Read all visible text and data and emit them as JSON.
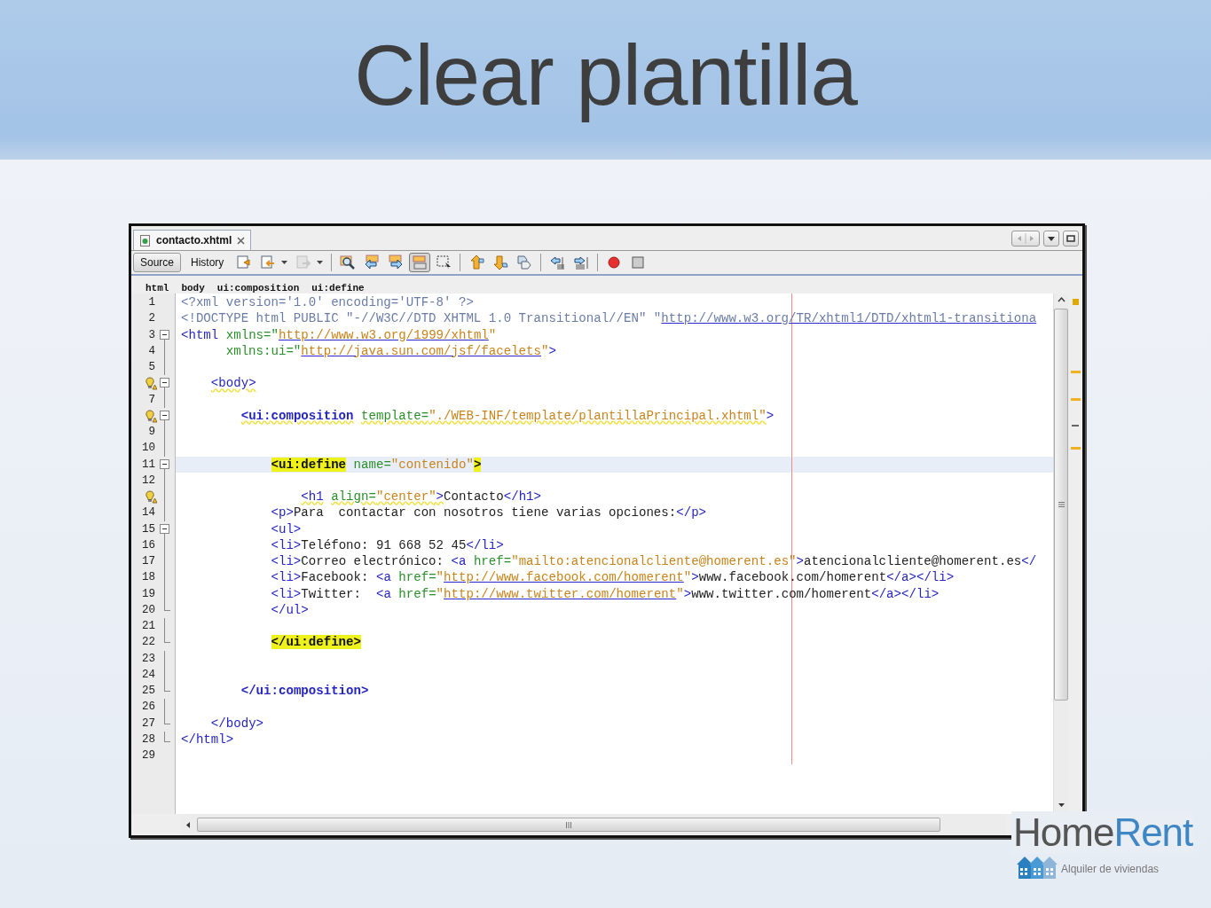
{
  "slide": {
    "title": "Clear plantilla"
  },
  "editor": {
    "file_tabs": [
      {
        "label": "contacto.xhtml",
        "selected": true
      }
    ],
    "views": [
      {
        "label": "Source",
        "selected": true
      },
      {
        "label": "History",
        "selected": false
      }
    ],
    "toolbar": [
      {
        "kind": "last-edit",
        "pressed": false,
        "disabled": false
      },
      {
        "kind": "back",
        "pressed": false,
        "disabled": false
      },
      {
        "kind": "caret",
        "pressed": false,
        "disabled": false
      },
      {
        "kind": "forward",
        "pressed": false,
        "disabled": true
      },
      {
        "kind": "caret",
        "pressed": false,
        "disabled": false
      },
      {
        "kind": "sep"
      },
      {
        "kind": "find",
        "pressed": false,
        "disabled": false
      },
      {
        "kind": "find-prev",
        "pressed": false,
        "disabled": false
      },
      {
        "kind": "find-next",
        "pressed": false,
        "disabled": false
      },
      {
        "kind": "highlight",
        "pressed": true,
        "disabled": false
      },
      {
        "kind": "rect-select",
        "pressed": false,
        "disabled": false
      },
      {
        "kind": "sep"
      },
      {
        "kind": "bookmark-prev",
        "pressed": false,
        "disabled": false
      },
      {
        "kind": "bookmark-next",
        "pressed": false,
        "disabled": false
      },
      {
        "kind": "bookmark-toggle",
        "pressed": false,
        "disabled": false
      },
      {
        "kind": "sep"
      },
      {
        "kind": "shift-left",
        "pressed": false,
        "disabled": false
      },
      {
        "kind": "shift-right",
        "pressed": false,
        "disabled": false
      },
      {
        "kind": "sep"
      },
      {
        "kind": "record",
        "pressed": false,
        "disabled": false
      },
      {
        "kind": "stop",
        "pressed": false,
        "disabled": false
      }
    ],
    "breadcrumbs": [
      "html",
      "body",
      "ui:composition",
      "ui:define"
    ],
    "lines": [
      {
        "number": "1",
        "fold_start": false,
        "fold_end": false,
        "hint": false,
        "current": false,
        "tokens": [
          {
            "kind": "pi",
            "text": "<?xml version='1.0' encoding='UTF-8' ?>"
          }
        ]
      },
      {
        "number": "2",
        "fold_start": false,
        "fold_end": false,
        "hint": false,
        "current": false,
        "tokens": [
          {
            "kind": "pi",
            "text": "<!DOCTYPE html PUBLIC \"-//W3C//DTD XHTML 1.0 Transitional//EN\" \""
          },
          {
            "kind": "pi_url",
            "text": "http://www.w3.org/TR/xhtml1/DTD/xhtml1-transitiona"
          }
        ]
      },
      {
        "number": "3",
        "fold_start": true,
        "fold_end": false,
        "hint": false,
        "current": false,
        "tokens": [
          {
            "kind": "tag",
            "text": "<html"
          },
          {
            "kind": "attr",
            "text": " xmlns=\""
          },
          {
            "kind": "url",
            "text": "http://www.w3.org/1999/xhtml"
          },
          {
            "kind": "value",
            "text": "\""
          }
        ]
      },
      {
        "number": "4",
        "fold_start": false,
        "fold_end": false,
        "hint": false,
        "current": false,
        "tokens": [
          {
            "kind": "attr",
            "text": "      xmlns:ui=\""
          },
          {
            "kind": "url",
            "text": "http://java.sun.com/jsf/facelets"
          },
          {
            "kind": "value",
            "text": "\""
          },
          {
            "kind": "tag",
            "text": ">"
          }
        ]
      },
      {
        "number": "5",
        "fold_start": false,
        "fold_end": false,
        "hint": false,
        "current": false
      },
      {
        "fold_start": true,
        "fold_end": false,
        "hint": true,
        "current": false,
        "tokens": [
          {
            "kind": "tag_warn",
            "text": "    <body>"
          }
        ]
      },
      {
        "number": "7",
        "fold_start": false,
        "fold_end": false,
        "hint": false,
        "current": false
      },
      {
        "fold_start": true,
        "fold_end": false,
        "hint": true,
        "current": false,
        "tokens": [
          {
            "kind": "tag_bold_warn",
            "text": "        <ui:composition"
          },
          {
            "kind": "attr_warn",
            "text": " template="
          },
          {
            "kind": "value_warn",
            "text": "\"./WEB-INF/template/plantillaPrincipal.xhtml\""
          },
          {
            "kind": "tag",
            "text": ">"
          }
        ]
      },
      {
        "number": "9",
        "fold_start": false,
        "fold_end": false,
        "hint": false,
        "current": false
      },
      {
        "number": "10",
        "fold_start": false,
        "fold_end": false,
        "hint": false,
        "current": false
      },
      {
        "number": "11",
        "fold_start": true,
        "fold_end": false,
        "hint": false,
        "current": true,
        "tokens": [
          {
            "kind": "match",
            "text": "            <ui:define"
          },
          {
            "kind": "attr",
            "text": " name="
          },
          {
            "kind": "value",
            "text": "\"contenido\""
          },
          {
            "kind": "match",
            "text": ">"
          }
        ]
      },
      {
        "number": "12",
        "fold_start": false,
        "fold_end": false,
        "hint": false,
        "current": false
      },
      {
        "fold_start": false,
        "fold_end": false,
        "hint": true,
        "current": false,
        "tokens": [
          {
            "kind": "tag_warn",
            "text": "                <h1"
          },
          {
            "kind": "attr_warn",
            "text": " align="
          },
          {
            "kind": "value_warn",
            "text": "\"center\""
          },
          {
            "kind": "tag_warn",
            "text": ">"
          },
          {
            "kind": "text",
            "text": "Contacto"
          },
          {
            "kind": "tag",
            "text": "</h1>"
          }
        ]
      },
      {
        "number": "14",
        "fold_start": false,
        "fold_end": false,
        "hint": false,
        "current": false,
        "tokens": [
          {
            "kind": "tag",
            "text": "            <p>"
          },
          {
            "kind": "text",
            "text": "Para  contactar con nosotros tiene varias opciones:"
          },
          {
            "kind": "tag",
            "text": "</p>"
          }
        ]
      },
      {
        "number": "15",
        "fold_start": true,
        "fold_end": false,
        "hint": false,
        "current": false,
        "tokens": [
          {
            "kind": "tag",
            "text": "            <ul>"
          }
        ]
      },
      {
        "number": "16",
        "fold_start": false,
        "fold_end": false,
        "hint": false,
        "current": false,
        "tokens": [
          {
            "kind": "tag",
            "text": "            <li>"
          },
          {
            "kind": "text",
            "text": "Teléfono: 91 668 52 45"
          },
          {
            "kind": "tag",
            "text": "</li>"
          }
        ]
      },
      {
        "number": "17",
        "fold_start": false,
        "fold_end": false,
        "hint": false,
        "current": false,
        "tokens": [
          {
            "kind": "tag",
            "text": "            <li>"
          },
          {
            "kind": "text",
            "text": "Correo electrónico: "
          },
          {
            "kind": "tag",
            "text": "<a"
          },
          {
            "kind": "attr",
            "text": " href="
          },
          {
            "kind": "value",
            "text": "\"mailto:atencionalcliente@homerent.es\""
          },
          {
            "kind": "tag",
            "text": ">"
          },
          {
            "kind": "text",
            "text": "atencionalcliente@homerent.es"
          },
          {
            "kind": "tag",
            "text": "</"
          }
        ]
      },
      {
        "number": "18",
        "fold_start": false,
        "fold_end": false,
        "hint": false,
        "current": false,
        "tokens": [
          {
            "kind": "tag",
            "text": "            <li>"
          },
          {
            "kind": "text",
            "text": "Facebook: "
          },
          {
            "kind": "tag",
            "text": "<a"
          },
          {
            "kind": "attr",
            "text": " href="
          },
          {
            "kind": "value",
            "text": "\""
          },
          {
            "kind": "url",
            "text": "http://www.facebook.com/homerent"
          },
          {
            "kind": "value",
            "text": "\""
          },
          {
            "kind": "tag",
            "text": ">"
          },
          {
            "kind": "text",
            "text": "www.facebook.com/homerent"
          },
          {
            "kind": "tag",
            "text": "</a></li>"
          }
        ]
      },
      {
        "number": "19",
        "fold_start": false,
        "fold_end": false,
        "hint": false,
        "current": false,
        "tokens": [
          {
            "kind": "tag",
            "text": "            <li>"
          },
          {
            "kind": "text",
            "text": "Twitter:  "
          },
          {
            "kind": "tag",
            "text": "<a"
          },
          {
            "kind": "attr",
            "text": " href="
          },
          {
            "kind": "value",
            "text": "\""
          },
          {
            "kind": "url",
            "text": "http://www.twitter.com/homerent"
          },
          {
            "kind": "value",
            "text": "\""
          },
          {
            "kind": "tag",
            "text": ">"
          },
          {
            "kind": "text",
            "text": "www.twitter.com/homerent"
          },
          {
            "kind": "tag",
            "text": "</a></li>"
          }
        ]
      },
      {
        "number": "20",
        "fold_start": false,
        "fold_end": true,
        "hint": false,
        "current": false,
        "tokens": [
          {
            "kind": "tag",
            "text": "            </ul>"
          }
        ]
      },
      {
        "number": "21",
        "fold_start": false,
        "fold_end": false,
        "hint": false,
        "current": false
      },
      {
        "number": "22",
        "fold_start": false,
        "fold_end": true,
        "hint": false,
        "current": false,
        "tokens": [
          {
            "kind": "match",
            "text": "            </ui:define>"
          }
        ]
      },
      {
        "number": "23",
        "fold_start": false,
        "fold_end": false,
        "hint": false,
        "current": false
      },
      {
        "number": "24",
        "fold_start": false,
        "fold_end": false,
        "hint": false,
        "current": false
      },
      {
        "number": "25",
        "fold_start": false,
        "fold_end": true,
        "hint": false,
        "current": false,
        "tokens": [
          {
            "kind": "tag_bold",
            "text": "        </ui:composition>"
          }
        ]
      },
      {
        "number": "26",
        "fold_start": false,
        "fold_end": false,
        "hint": false,
        "current": false
      },
      {
        "number": "27",
        "fold_start": false,
        "fold_end": true,
        "hint": false,
        "current": false,
        "tokens": [
          {
            "kind": "tag",
            "text": "    </body>"
          }
        ]
      },
      {
        "number": "28",
        "fold_start": false,
        "fold_end": true,
        "hint": false,
        "current": false,
        "tokens": [
          {
            "kind": "tag",
            "text": "</html>"
          }
        ]
      },
      {
        "number": "29",
        "fold_start": false,
        "fold_end": false,
        "hint": false,
        "current": false
      }
    ]
  },
  "brand": {
    "name_parts": [
      "Home",
      "Rent"
    ],
    "tagline": "Alquiler de viviendas"
  }
}
